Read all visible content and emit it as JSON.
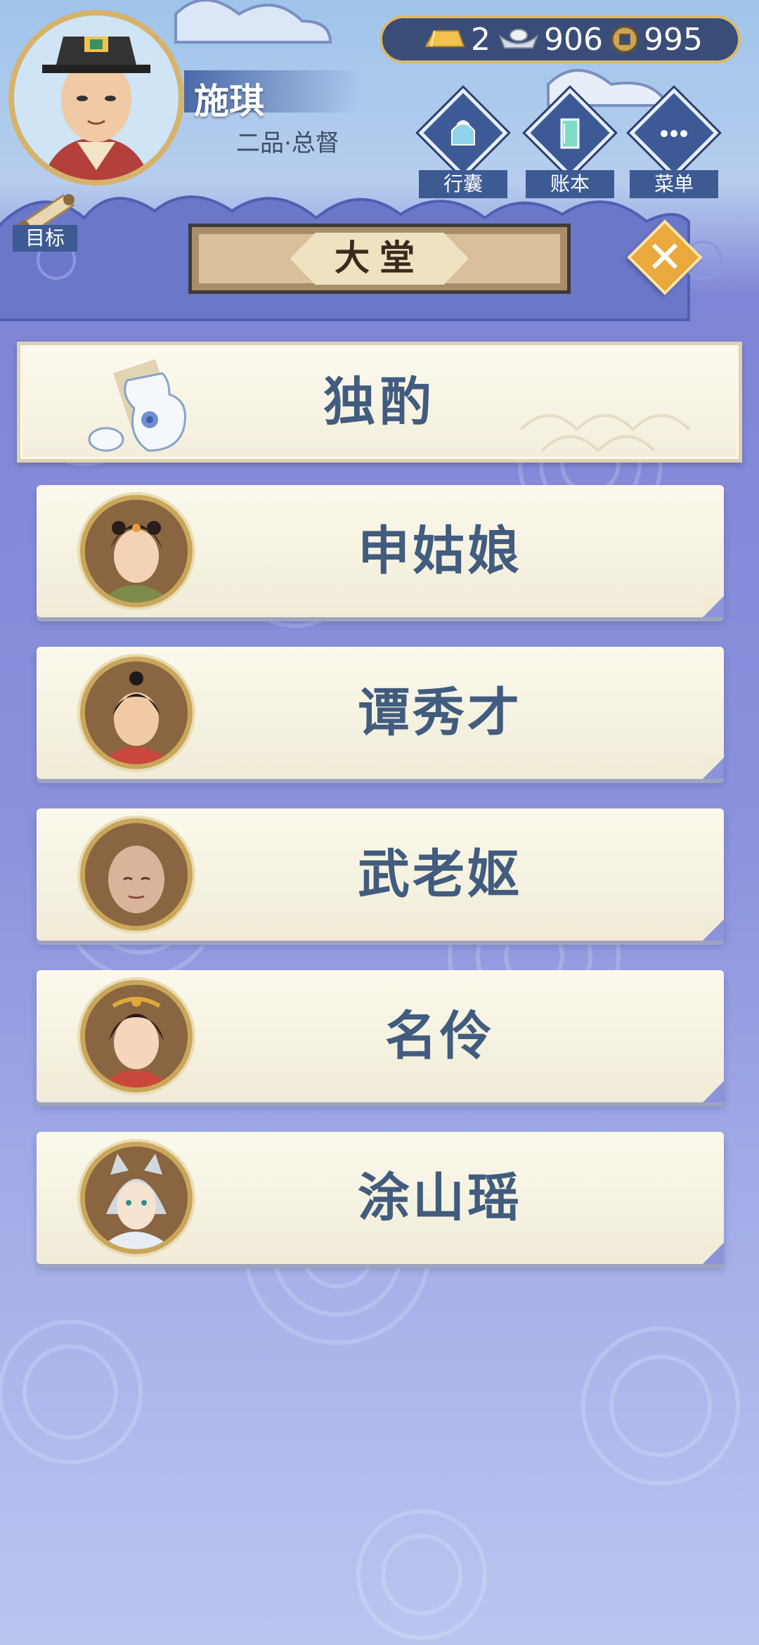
{
  "player": {
    "name": "施琪",
    "rank": "二品·总督"
  },
  "currency": {
    "gold": "2",
    "silver": "906",
    "coins": "995"
  },
  "menu": {
    "bag_label": "行囊",
    "ledger_label": "账本",
    "menu_label": "菜单",
    "target_label": "目标"
  },
  "hall": {
    "title": "大堂"
  },
  "featured": {
    "name": "独酌"
  },
  "characters": [
    {
      "name": "申姑娘"
    },
    {
      "name": "谭秀才"
    },
    {
      "name": "武老妪"
    },
    {
      "name": "名伶"
    },
    {
      "name": "涂山瑶"
    }
  ],
  "colors": {
    "accent": "#3e5a93",
    "gold_border": "#d9b96b",
    "name_text": "#415c7e",
    "close_button": "#e9a93c"
  }
}
